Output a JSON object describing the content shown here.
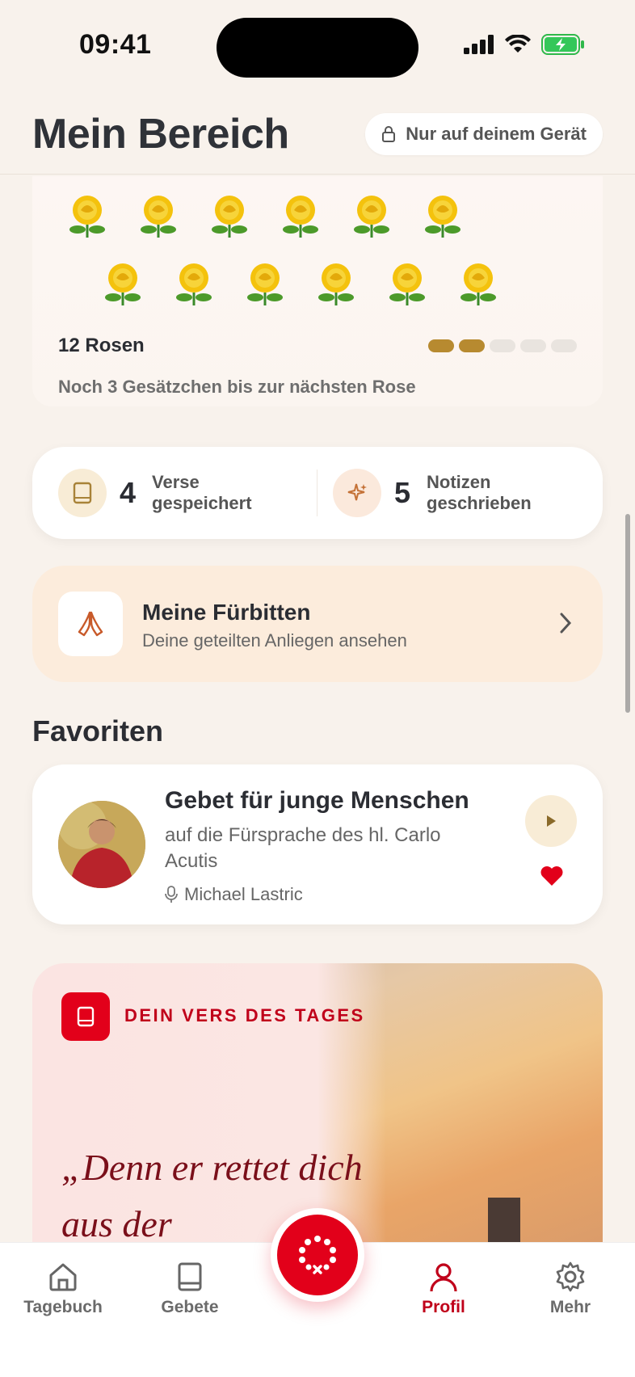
{
  "status_bar": {
    "time": "09:41"
  },
  "header": {
    "title": "Mein Bereich",
    "privacy_pill": "Nur auf deinem Gerät"
  },
  "roses": {
    "row1": [
      "🌼",
      "🌼",
      "🌼",
      "🌼",
      "🌼",
      "🌼"
    ],
    "count_label": "12 Rosen",
    "progress_filled": 2,
    "progress_total": 5,
    "hint": "Noch 3 Gesätzchen bis zur nächsten Rose"
  },
  "stats": {
    "verses": {
      "count": "4",
      "label": "Verse gespeichert",
      "icon": "book-icon"
    },
    "notes": {
      "count": "5",
      "label": "Notizen geschrieben",
      "icon": "sparkle-icon"
    }
  },
  "intercessions": {
    "title": "Meine Fürbitten",
    "subtitle": "Deine geteilten Anliegen ansehen",
    "icon": "praying-hands-icon"
  },
  "favorites": {
    "section_title": "Favoriten",
    "item": {
      "title": "Gebet für junge Menschen",
      "subtitle": "auf die Fürsprache des hl. Carlo Acutis",
      "author": "Michael Lastric",
      "favorited": true
    }
  },
  "verse_of_day": {
    "kicker": "DEIN VERS DES TAGES",
    "text": "„Denn er rettet dich aus der"
  },
  "tabbar": {
    "tabs": [
      {
        "label": "Tagebuch",
        "icon": "home-icon",
        "active": false
      },
      {
        "label": "Gebete",
        "icon": "book-icon",
        "active": false
      },
      {
        "label": "Profil",
        "icon": "person-icon",
        "active": true
      },
      {
        "label": "Mehr",
        "icon": "gear-icon",
        "active": false
      }
    ],
    "center_icon": "rosary-icon"
  },
  "colors": {
    "accent": "#e2001a",
    "gold": "#b78a30",
    "background": "#f8f2ec"
  }
}
